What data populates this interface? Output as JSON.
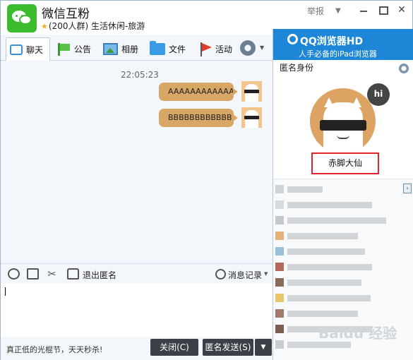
{
  "header": {
    "group_name": "微信互粉",
    "group_sub": "(200人群) 生活休闲-旅游",
    "report_label": "举报"
  },
  "toolbar": {
    "tabs": [
      "聊天",
      "公告",
      "相册",
      "文件",
      "活动"
    ]
  },
  "chat": {
    "time": "22:05:23",
    "messages": [
      "AAAAAAAAAAAA",
      "BBBBBBBBBBBB"
    ]
  },
  "input_tools": {
    "exit_anon_label": "退出匿名",
    "history_label": "消息记录"
  },
  "bottom": {
    "promo": "真正低的光棍节，天天秒杀!",
    "close_label": "关闭(C)",
    "send_label": "匿名发送(S)"
  },
  "ad": {
    "title": "QQ浏览器HD",
    "subtitle": "人手必备的iPad浏览器"
  },
  "right_panel": {
    "title": "匿名身份",
    "avatar_badge": "hi",
    "nickname": "赤脚大仙"
  },
  "watermark": "Baidu 经验",
  "colors": {
    "accent": "#1d86d6",
    "bubble": "#d9a765",
    "button": "#3b4047",
    "highlight": "#e0232b",
    "logo": "#3cbb2f"
  }
}
